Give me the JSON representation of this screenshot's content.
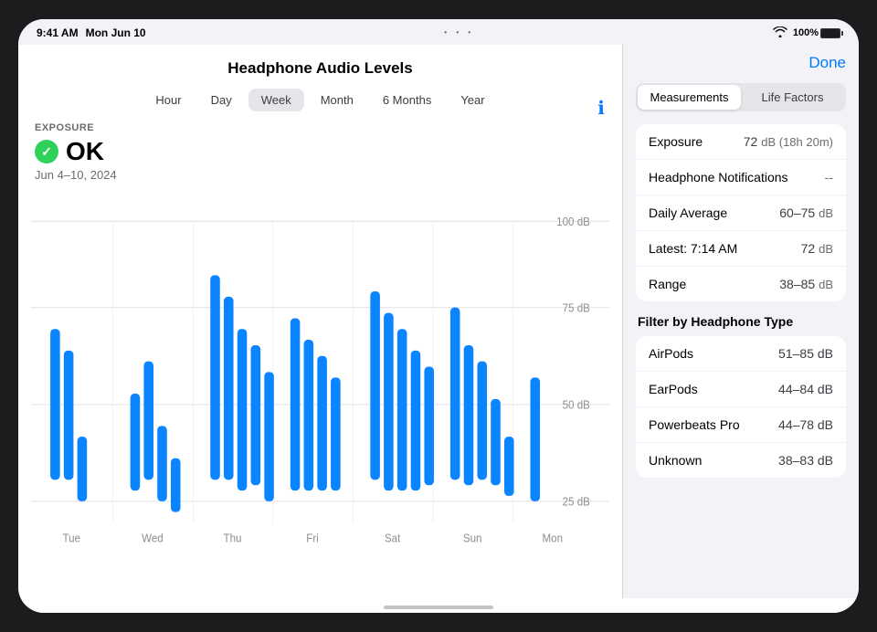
{
  "statusBar": {
    "time": "9:41 AM",
    "date": "Mon Jun 10",
    "battery": "100%"
  },
  "header": {
    "title": "Headphone Audio Levels",
    "doneLabel": "Done"
  },
  "timeTabs": {
    "tabs": [
      "Hour",
      "Day",
      "Week",
      "Month",
      "6 Months",
      "Year"
    ],
    "activeTab": "Week"
  },
  "exposure": {
    "sectionLabel": "EXPOSURE",
    "status": "OK",
    "dateRange": "Jun 4–10, 2024"
  },
  "chart": {
    "yLabels": [
      "100 dB",
      "75 dB",
      "50 dB",
      "25 dB"
    ],
    "xLabels": [
      "Tue",
      "Wed",
      "Thu",
      "Fri",
      "Sat",
      "Sun",
      "Mon"
    ]
  },
  "rightPanel": {
    "segmentLabels": [
      "Measurements",
      "Life Factors"
    ],
    "activeSegment": "Measurements",
    "metrics": [
      {
        "label": "Exposure",
        "value": "72",
        "unit": "dB (18h 20m)"
      },
      {
        "label": "Headphone Notifications",
        "value": "--",
        "unit": ""
      },
      {
        "label": "Daily Average",
        "value": "60–75",
        "unit": "dB"
      },
      {
        "label": "Latest: 7:14 AM",
        "value": "72",
        "unit": "dB"
      },
      {
        "label": "Range",
        "value": "38–85",
        "unit": "dB"
      }
    ],
    "filterTitle": "Filter by Headphone Type",
    "filters": [
      {
        "label": "AirPods",
        "value": "51–85 dB"
      },
      {
        "label": "EarPods",
        "value": "44–84 dB"
      },
      {
        "label": "Powerbeats Pro",
        "value": "44–78 dB"
      },
      {
        "label": "Unknown",
        "value": "38–83 dB"
      }
    ]
  }
}
